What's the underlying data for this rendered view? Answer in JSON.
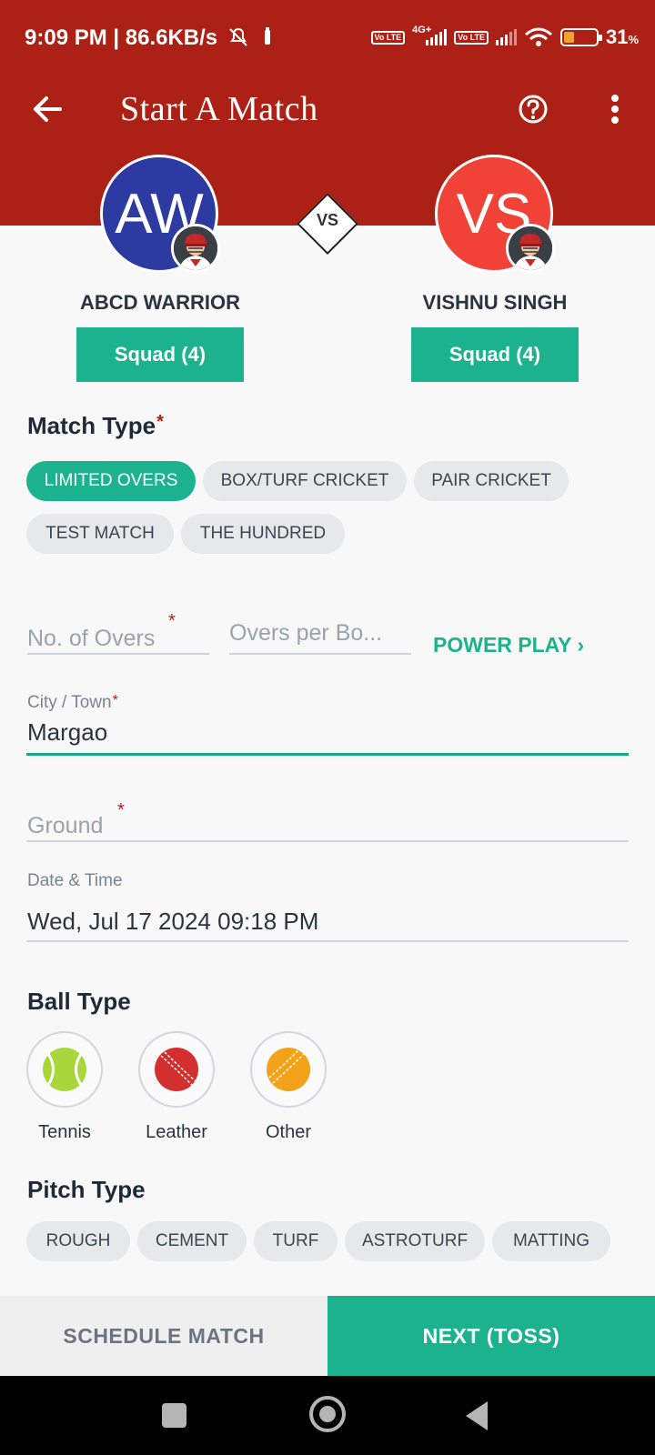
{
  "status_bar": {
    "time_speed": "9:09 PM | 86.6KB/s",
    "network_1": "4G+",
    "lte_label": "Vo LTE",
    "battery": "31",
    "battery_unit": "%",
    "battery_level_percent": 31
  },
  "app_bar": {
    "title": "Start A Match"
  },
  "teams": {
    "a": {
      "initials": "AW",
      "name": "ABCD WARRIOR",
      "squad": "Squad (4)",
      "color": "#2d3aa2"
    },
    "vs_label": "VS",
    "b": {
      "initials": "VS",
      "name": "VISHNU SINGH",
      "squad": "Squad (4)",
      "color": "#f04237"
    }
  },
  "match_type": {
    "title": "Match Type",
    "required_mark": "*",
    "options": [
      "LIMITED OVERS",
      "BOX/TURF CRICKET",
      "PAIR CRICKET",
      "TEST MATCH",
      "THE HUNDRED"
    ],
    "selected": "LIMITED OVERS"
  },
  "overs": {
    "no_of_overs_placeholder": "No. of Overs",
    "overs_per_bowler_placeholder": "Overs per Bo...",
    "power_play_label": "POWER PLAY ›"
  },
  "city": {
    "label": "City / Town",
    "value": "Margao"
  },
  "ground": {
    "placeholder": "Ground"
  },
  "date_time": {
    "label": "Date & Time",
    "value": "Wed, Jul 17 2024 09:18 PM"
  },
  "ball_type": {
    "title": "Ball Type",
    "options": [
      {
        "label": "Tennis",
        "icon": "tennis-ball-icon"
      },
      {
        "label": "Leather",
        "icon": "leather-ball-icon"
      },
      {
        "label": "Other",
        "icon": "other-ball-icon"
      }
    ]
  },
  "pitch_type": {
    "title": "Pitch Type",
    "options": [
      "ROUGH",
      "CEMENT",
      "TURF",
      "ASTROTURF",
      "MATTING"
    ]
  },
  "actions": {
    "schedule_label": "SCHEDULE MATCH",
    "next_label": "NEXT (TOSS)"
  },
  "colors": {
    "header": "#ad2015",
    "accent": "#1db28e"
  }
}
